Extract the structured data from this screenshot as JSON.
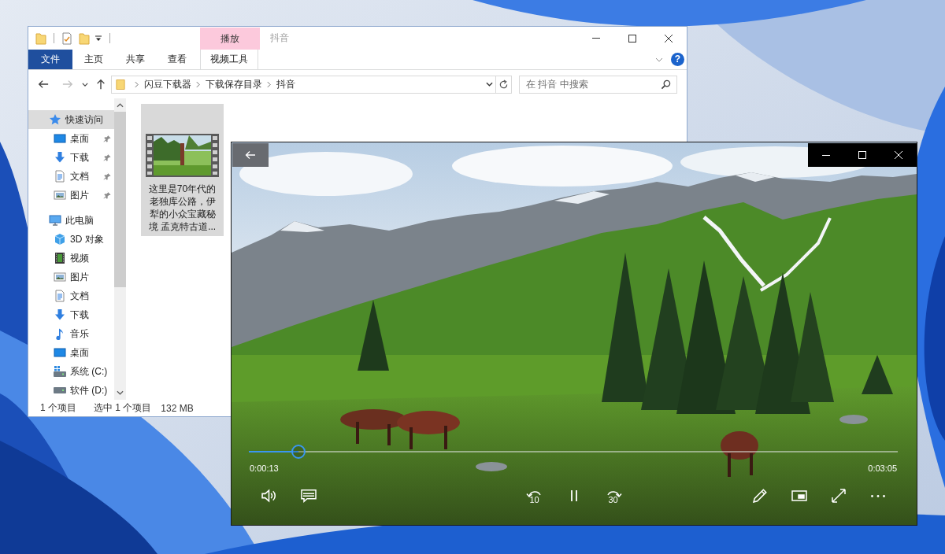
{
  "explorer": {
    "title": "抖音",
    "contextual_tab": "播放",
    "ribbon_tabs": [
      {
        "label": "文件",
        "kind": "file"
      },
      {
        "label": "主页",
        "kind": "tab"
      },
      {
        "label": "共享",
        "kind": "tab"
      },
      {
        "label": "查看",
        "kind": "tab"
      },
      {
        "label": "视频工具",
        "kind": "contextual"
      }
    ],
    "help": "?",
    "nav_buttons": [
      {
        "kind": "back",
        "disabled": false
      },
      {
        "kind": "forward",
        "disabled": true
      },
      {
        "kind": "recent",
        "disabled": false
      },
      {
        "kind": "up",
        "disabled": false
      }
    ],
    "address": [
      "闪豆下载器",
      "下载保存目录",
      "抖音"
    ],
    "search": {
      "placeholder": "在 抖音 中搜索"
    },
    "nav_tree": [
      {
        "label": "快速访问",
        "kind": "star",
        "selected": true,
        "children": [
          {
            "label": "桌面",
            "kind": "desktop",
            "selected": false,
            "pinned": true
          },
          {
            "label": "下载",
            "kind": "download",
            "selected": false,
            "pinned": true
          },
          {
            "label": "文档",
            "kind": "document",
            "selected": false,
            "pinned": true
          },
          {
            "label": "图片",
            "kind": "picture",
            "selected": false,
            "pinned": true
          }
        ]
      },
      {
        "label": "此电脑",
        "kind": "pc",
        "selected": false,
        "children": [
          {
            "label": "3D 对象",
            "kind": "cube",
            "selected": false
          },
          {
            "label": "视频",
            "kind": "video",
            "selected": false
          },
          {
            "label": "图片",
            "kind": "picture",
            "selected": false
          },
          {
            "label": "文档",
            "kind": "document",
            "selected": false
          },
          {
            "label": "下载",
            "kind": "download",
            "selected": false
          },
          {
            "label": "音乐",
            "kind": "music",
            "selected": false
          },
          {
            "label": "桌面",
            "kind": "desktop",
            "selected": false
          },
          {
            "label": "系统 (C:)",
            "kind": "system_drive",
            "selected": false
          },
          {
            "label": "软件 (D:)",
            "kind": "drive",
            "selected": false
          }
        ]
      }
    ],
    "files": [
      {
        "name": "这里是70年代的老独库公路，伊犁的小众宝藏秘境 孟克特古道...",
        "selected": true
      }
    ],
    "status_bar": {
      "item_count": "1 个项目",
      "selection": "选中 1 个项目",
      "size": "132 MB"
    }
  },
  "player": {
    "playing": true,
    "progress": {
      "level": 0.076
    },
    "elapsed": "0:00:13",
    "duration": "0:03:05",
    "left_controls": [
      {
        "kind": "volume"
      },
      {
        "kind": "captions"
      }
    ],
    "center_controls": [
      {
        "kind": "skip_back",
        "label": "10"
      },
      {
        "kind": "play_pause"
      },
      {
        "kind": "skip_forward",
        "label": "30"
      }
    ],
    "right_controls": [
      {
        "kind": "edit"
      },
      {
        "kind": "mini_view"
      },
      {
        "kind": "fullscreen"
      },
      {
        "kind": "more"
      }
    ]
  }
}
